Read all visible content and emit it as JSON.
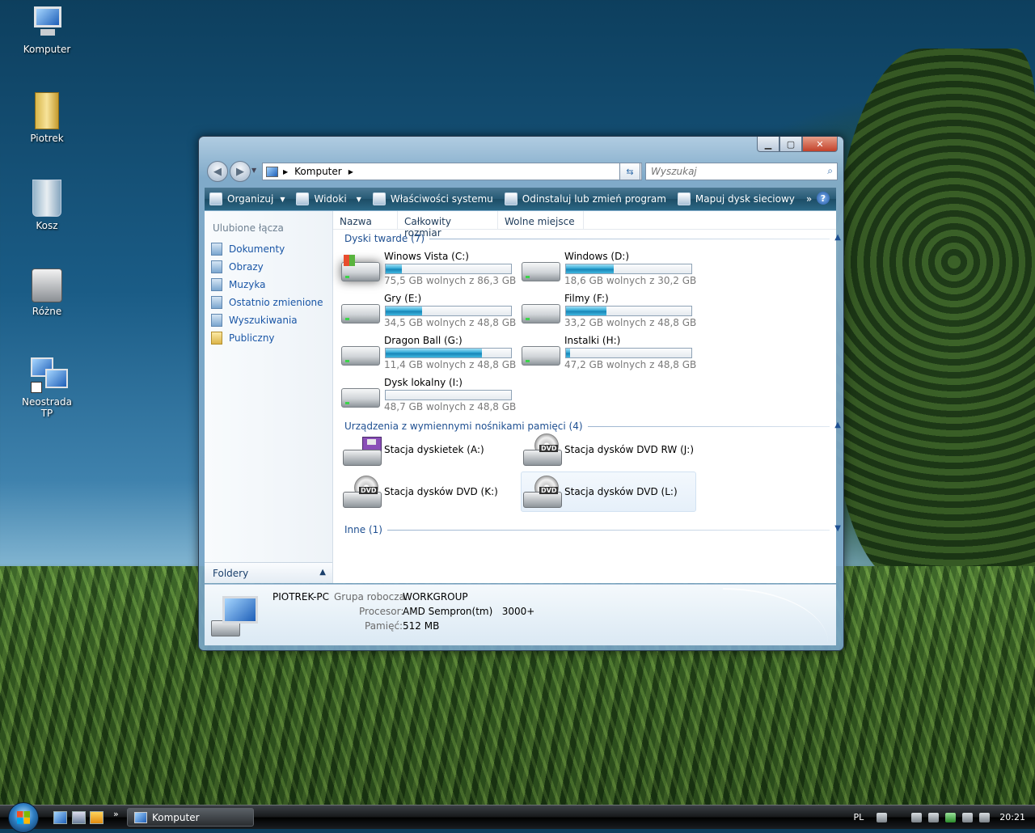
{
  "desktop": {
    "icons": [
      {
        "label": "Komputer"
      },
      {
        "label": "Piotrek"
      },
      {
        "label": "Kosz"
      },
      {
        "label": "Różne"
      },
      {
        "label": "Neostrada TP"
      }
    ]
  },
  "window": {
    "address": {
      "crumb": "Komputer"
    },
    "search_placeholder": "Wyszukaj",
    "toolbar": {
      "organize": "Organizuj",
      "views": "Widoki",
      "system_properties": "Właściwości systemu",
      "uninstall": "Odinstaluj lub zmień program",
      "map_drive": "Mapuj dysk sieciowy",
      "more": "»",
      "help": "?"
    },
    "nav": {
      "title": "Ulubione łącza",
      "links": [
        "Dokumenty",
        "Obrazy",
        "Muzyka",
        "Ostatnio zmienione",
        "Wyszukiwania",
        "Publiczny"
      ],
      "folders": "Foldery"
    },
    "columns": [
      "Nazwa",
      "Całkowity rozmiar",
      "Wolne miejsce"
    ],
    "groups": {
      "hard": "Dyski twarde (7)",
      "removable": "Urządzenia z wymiennymi nośnikami pamięci (4)",
      "other": "Inne (1)"
    },
    "drives": [
      {
        "name": "Winows Vista (C:)",
        "free": "75,5 GB wolnych z 86,3 GB",
        "used_fraction": 0.13
      },
      {
        "name": "Windows (D:)",
        "free": "18,6 GB wolnych z 30,2 GB",
        "used_fraction": 0.38
      },
      {
        "name": "Gry (E:)",
        "free": "34,5 GB wolnych z 48,8 GB",
        "used_fraction": 0.29
      },
      {
        "name": "Filmy (F:)",
        "free": "33,2 GB wolnych z 48,8 GB",
        "used_fraction": 0.32
      },
      {
        "name": "Dragon Ball (G:)",
        "free": "11,4 GB wolnych z 48,8 GB",
        "used_fraction": 0.77
      },
      {
        "name": "Instalki (H:)",
        "free": "47,2 GB wolnych z 48,8 GB",
        "used_fraction": 0.03
      },
      {
        "name": "Dysk lokalny (I:)",
        "free": "48,7 GB wolnych z 48,8 GB",
        "used_fraction": 0.0
      }
    ],
    "removable": [
      {
        "name": "Stacja dyskietek (A:)",
        "icon": "floppy-icon"
      },
      {
        "name": "Stacja dysków DVD RW (J:)",
        "icon": "dvd-icon"
      },
      {
        "name": "Stacja dysków DVD (K:)",
        "icon": "dvd-icon"
      },
      {
        "name": "Stacja dysków DVD (L:)",
        "icon": "dvd-icon"
      }
    ],
    "dvd_label": "DVD",
    "details": {
      "computer_name": "PIOTREK-PC",
      "workgroup_label": "Grupa robocza:",
      "workgroup": "WORKGROUP",
      "cpu_label": "Procesor:",
      "cpu": "AMD Sempron(tm)   3000+",
      "ram_label": "Pamięć:",
      "ram": "512 MB"
    }
  },
  "taskbar": {
    "task": "Komputer",
    "more": "»",
    "lang": "PL",
    "clock": "20:21"
  },
  "colors": {
    "bar_fill": "#27a3d2",
    "link": "#1a56a6",
    "toolbar": "#265a75"
  }
}
